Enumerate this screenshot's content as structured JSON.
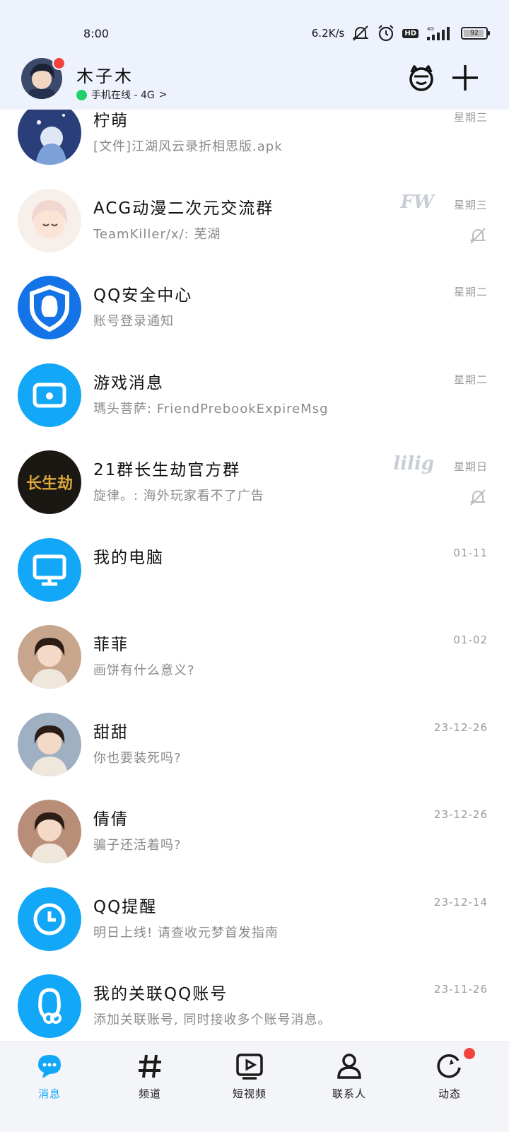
{
  "status_bar": {
    "time": "8:00",
    "net_speed": "6.2K/s",
    "hd": "HD",
    "network": "4G",
    "battery": "92",
    "battery_level": 0.92
  },
  "header": {
    "profile_name": "木子木",
    "online_status": "手机在线 - 4G",
    "chevron": ">",
    "right_icons": [
      "mascot-icon",
      "plus-icon"
    ]
  },
  "chats": [
    {
      "name": "柠萌",
      "preview": "[文件]江湖风云录折相思版.apk",
      "time": "星期三",
      "muted": false,
      "tag": "",
      "avatar": "anime-blue",
      "avatar_color": "#7ca0d8"
    },
    {
      "name": "ACG动漫二次元交流群",
      "preview": "TeamKiller/x/: 芜湖",
      "time": "星期三",
      "muted": true,
      "tag": "FW",
      "avatar": "anime-girl",
      "avatar_color": "#f0d7cf"
    },
    {
      "name": "QQ安全中心",
      "preview": "账号登录通知",
      "time": "星期二",
      "muted": false,
      "tag": "",
      "avatar": "shield",
      "avatar_color": "#1473e6"
    },
    {
      "name": "游戏消息",
      "preview": "瑪头菩萨: FriendPrebookExpireMsg",
      "time": "星期二",
      "muted": false,
      "tag": "",
      "avatar": "game",
      "avatar_color": "#12a7f7"
    },
    {
      "name": "21群长生劫官方群",
      "preview": "旋律。: 海外玩家看不了广告",
      "time": "星期日",
      "muted": true,
      "tag": "lilig",
      "avatar": "game-logo",
      "avatar_color": "#1b1712"
    },
    {
      "name": "我的电脑",
      "preview": "",
      "time": "01-11",
      "muted": false,
      "tag": "",
      "avatar": "monitor",
      "avatar_color": "#12a7f7"
    },
    {
      "name": "菲菲",
      "preview": "画饼有什么意义?",
      "time": "01-02",
      "muted": false,
      "tag": "",
      "avatar": "photo",
      "avatar_color": "#c8a58d"
    },
    {
      "name": "甜甜",
      "preview": "你也要装死吗?",
      "time": "23-12-26",
      "muted": false,
      "tag": "",
      "avatar": "photo",
      "avatar_color": "#9fb0c2"
    },
    {
      "name": "倩倩",
      "preview": "骗子还活着吗?",
      "time": "23-12-26",
      "muted": false,
      "tag": "",
      "avatar": "photo",
      "avatar_color": "#b98e78"
    },
    {
      "name": "QQ提醒",
      "preview": "明日上线! 请查收元梦首发指南",
      "time": "23-12-14",
      "muted": false,
      "tag": "",
      "avatar": "clock",
      "avatar_color": "#12a7f7"
    },
    {
      "name": "我的关联QQ账号",
      "preview": "添加关联账号, 同时接收多个账号消息。",
      "time": "23-11-26",
      "muted": false,
      "tag": "",
      "avatar": "link-account",
      "avatar_color": "#12a7f7"
    }
  ],
  "bottom_nav": {
    "items": [
      {
        "label": "消息",
        "icon": "chat-bubble-icon",
        "active": true
      },
      {
        "label": "频道",
        "icon": "hash-icon",
        "active": false
      },
      {
        "label": "短视频",
        "icon": "video-play-icon",
        "active": false
      },
      {
        "label": "联系人",
        "icon": "person-icon",
        "active": false
      },
      {
        "label": "动态",
        "icon": "refresh-star-icon",
        "active": false
      }
    ],
    "active_color": "#12a7f7"
  }
}
